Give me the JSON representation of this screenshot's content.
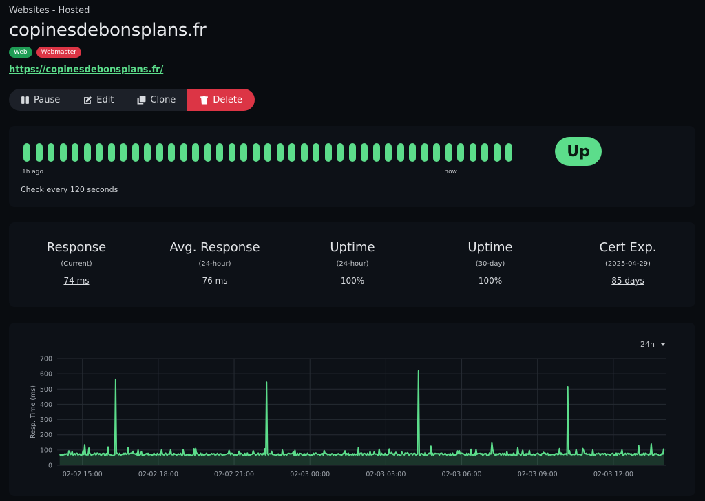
{
  "breadcrumb": "Websites - Hosted",
  "site": {
    "title": "copinesdebonsplans.fr",
    "url": "https://copinesdebonsplans.fr/",
    "tags": [
      {
        "label": "Web",
        "color": "#1f9d55"
      },
      {
        "label": "Webmaster",
        "color": "#dc3545"
      }
    ]
  },
  "toolbar": {
    "pause": "Pause",
    "edit": "Edit",
    "clone": "Clone",
    "delete": "Delete"
  },
  "heartbeat": {
    "beat_count": 41,
    "beat_color": "#5cdd8b",
    "left_label": "1h ago",
    "right_label": "now",
    "interval_text": "Check every 120 seconds",
    "status": "Up"
  },
  "stats": [
    {
      "title": "Response",
      "sub": "(Current)",
      "value": "74 ms",
      "link": true
    },
    {
      "title": "Avg. Response",
      "sub": "(24-hour)",
      "value": "76 ms",
      "link": false
    },
    {
      "title": "Uptime",
      "sub": "(24-hour)",
      "value": "100%",
      "link": false
    },
    {
      "title": "Uptime",
      "sub": "(30-day)",
      "value": "100%",
      "link": false
    },
    {
      "title": "Cert Exp.",
      "sub": "(2025-04-29)",
      "value": "85 days",
      "link": true
    }
  ],
  "range_select": "24h",
  "chart_data": {
    "type": "area",
    "ylabel": "Resp. Time (ms)",
    "ylim": [
      0,
      700
    ],
    "yticks": [
      0,
      100,
      200,
      300,
      400,
      500,
      600,
      700
    ],
    "xlim_hours": [
      14.0,
      38.1
    ],
    "xticks": [
      {
        "hour": 15,
        "label": "02-02 15:00"
      },
      {
        "hour": 18,
        "label": "02-02 18:00"
      },
      {
        "hour": 21,
        "label": "02-02 21:00"
      },
      {
        "hour": 24,
        "label": "02-03 00:00"
      },
      {
        "hour": 27,
        "label": "02-03 03:00"
      },
      {
        "hour": 30,
        "label": "02-03 06:00"
      },
      {
        "hour": 33,
        "label": "02-03 09:00"
      },
      {
        "hour": 36,
        "label": "02-03 12:00"
      }
    ],
    "baseline_ms": 72,
    "spikes": [
      {
        "hour": 15.1,
        "value": 135
      },
      {
        "hour": 16.3,
        "value": 565
      },
      {
        "hour": 16.0,
        "value": 120
      },
      {
        "hour": 16.8,
        "value": 115
      },
      {
        "hour": 22.3,
        "value": 545
      },
      {
        "hour": 28.3,
        "value": 620
      },
      {
        "hour": 28.8,
        "value": 125
      },
      {
        "hour": 25.9,
        "value": 115
      },
      {
        "hour": 31.2,
        "value": 150
      },
      {
        "hour": 34.2,
        "value": 515
      },
      {
        "hour": 34.8,
        "value": 110
      },
      {
        "hour": 37.0,
        "value": 130
      },
      {
        "hour": 37.5,
        "value": 140
      },
      {
        "hour": 38.0,
        "value": 110
      }
    ],
    "series": [
      {
        "name": "",
        "color": "#5cdd8b"
      }
    ],
    "grid": true
  }
}
